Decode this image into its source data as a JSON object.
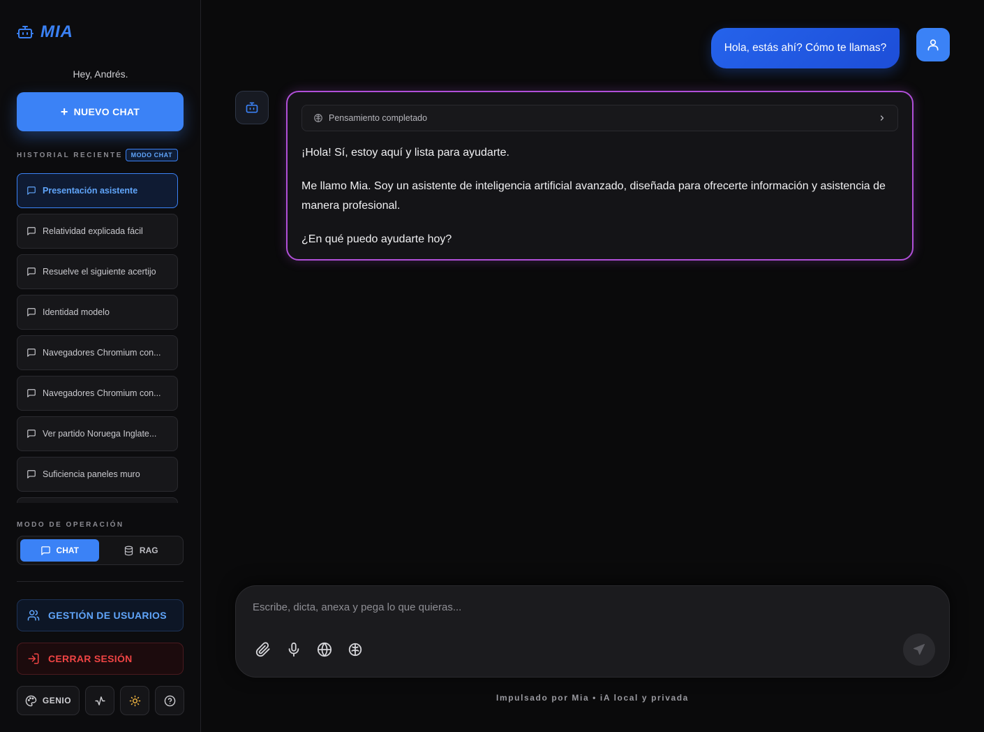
{
  "brand": {
    "name": "MIA"
  },
  "sidebar": {
    "greeting": "Hey, Andrés.",
    "new_chat": {
      "icon": "+",
      "label": "NUEVO CHAT"
    },
    "history_label": "HISTORIAL RECIENTE",
    "history_badge": "MODO CHAT",
    "history": [
      {
        "title": "Presentación asistente",
        "active": true
      },
      {
        "title": "Relatividad explicada fácil"
      },
      {
        "title": "Resuelve el siguiente acertijo"
      },
      {
        "title": "Identidad modelo"
      },
      {
        "title": "Navegadores Chromium con..."
      },
      {
        "title": "Navegadores Chromium con..."
      },
      {
        "title": "Ver partido Noruega Inglate..."
      },
      {
        "title": "Suficiencia paneles muro"
      }
    ],
    "operation_label": "MODO DE OPERACIÓN",
    "modes": {
      "chat": "CHAT",
      "rag": "RAG",
      "selected": "CHAT"
    },
    "users_button": "GESTIÓN DE USUARIOS",
    "logout_button": "CERRAR SESIÓN",
    "theme_button": "GENIO"
  },
  "chat": {
    "user_message": "Hola, estás ahí? Cómo te llamas?",
    "thinking_label": "Pensamiento completado",
    "assistant_paragraphs": [
      "¡Hola! Sí, estoy aquí y lista para ayudarte.",
      "Me llamo Mia. Soy un asistente de inteligencia artificial avanzado, diseñada para ofrecerte información y asistencia de manera profesional.",
      "¿En qué puedo ayudarte hoy?"
    ]
  },
  "composer": {
    "placeholder": "Escribe, dicta, anexa y pega lo que quieras..."
  },
  "footer": {
    "powered_by": "Impulsado por Mia • iA local y privada"
  },
  "colors": {
    "accent": "#3b82f6",
    "danger": "#ef4444",
    "glow": "#b04fd8"
  }
}
